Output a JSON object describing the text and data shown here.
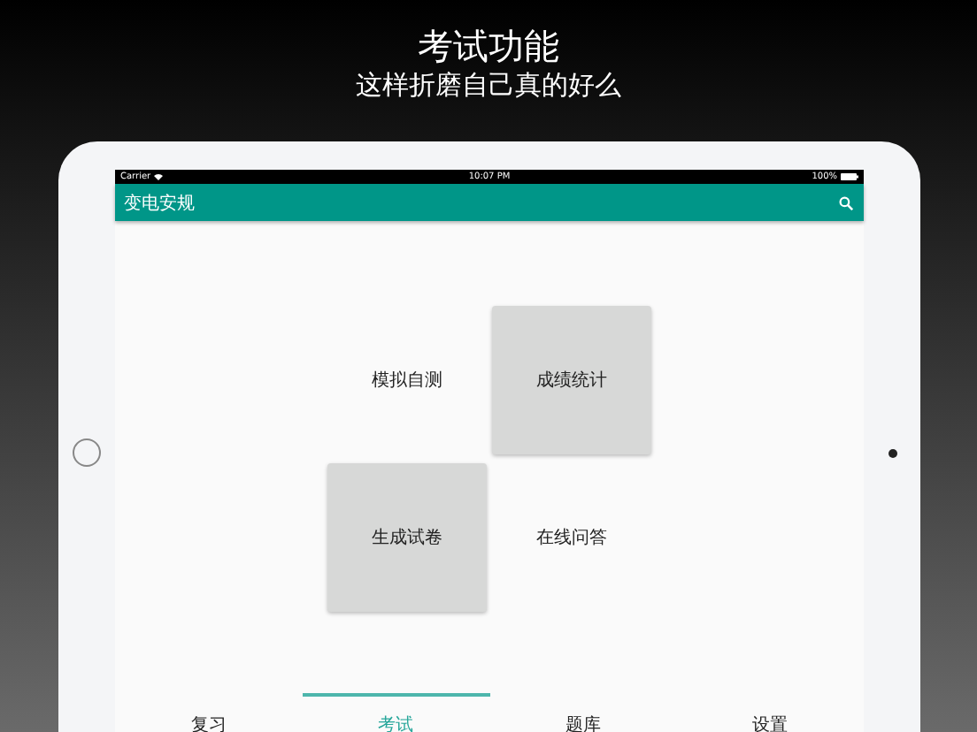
{
  "promo": {
    "title": "考试功能",
    "subtitle": "这样折磨自己真的好么"
  },
  "status_bar": {
    "carrier": "Carrier",
    "time": "10:07 PM",
    "battery": "100%"
  },
  "app_bar": {
    "title": "变电安规"
  },
  "tiles": [
    {
      "label": "模拟自测",
      "kind": "plain"
    },
    {
      "label": "成绩统计",
      "kind": "card"
    },
    {
      "label": "生成试卷",
      "kind": "card"
    },
    {
      "label": "在线问答",
      "kind": "plain"
    }
  ],
  "tabs": [
    {
      "label": "复习",
      "selected": false
    },
    {
      "label": "考试",
      "selected": true
    },
    {
      "label": "题库",
      "selected": false
    },
    {
      "label": "设置",
      "selected": false
    }
  ]
}
